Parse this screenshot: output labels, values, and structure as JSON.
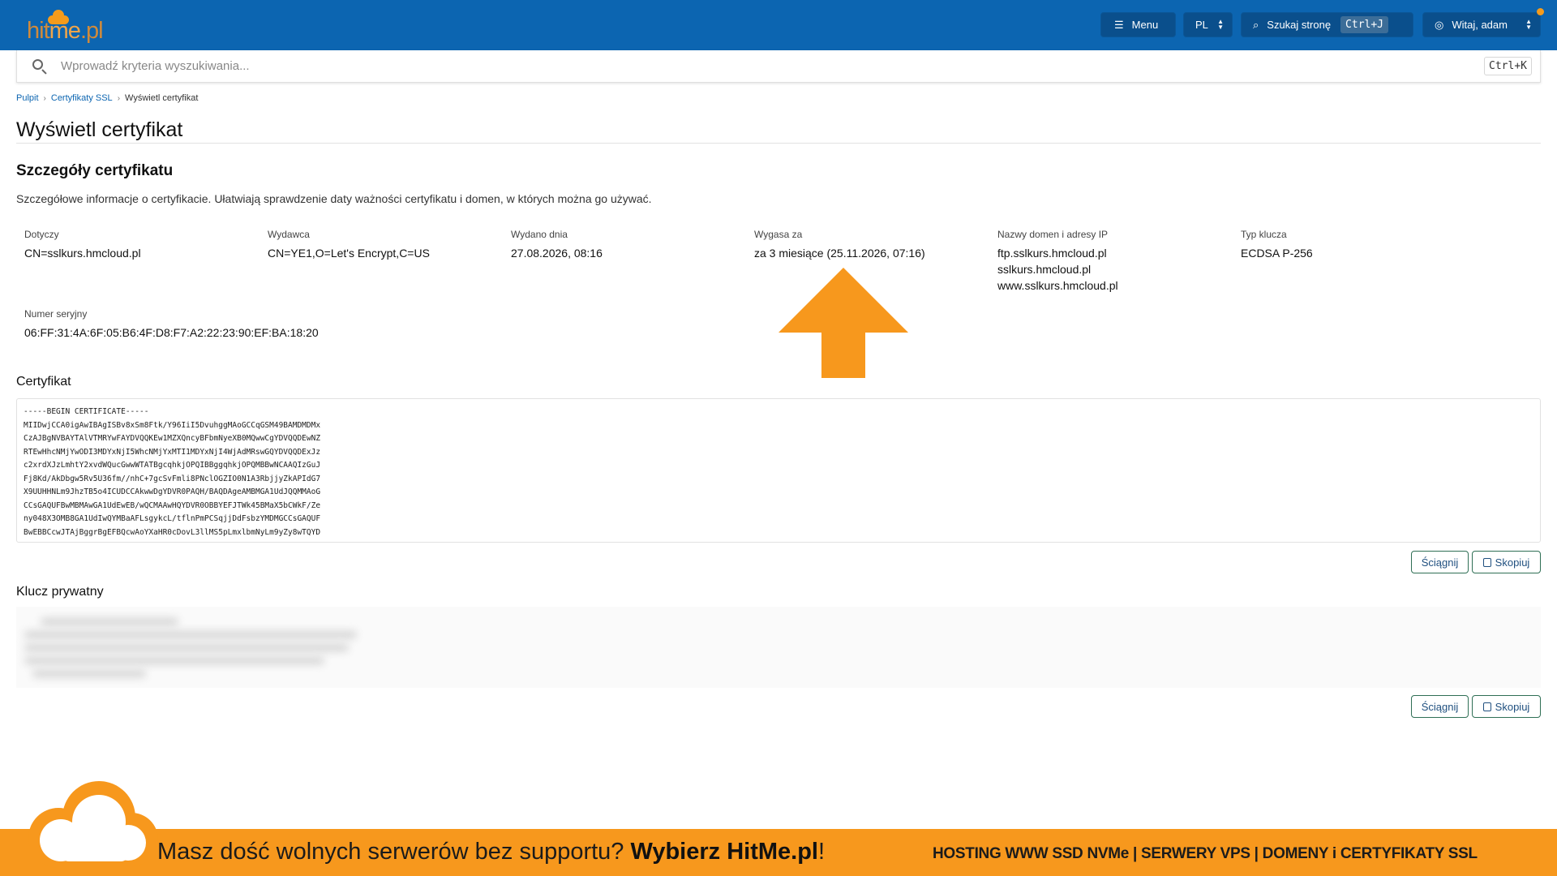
{
  "header": {
    "logo_text_a": "hit",
    "logo_text_b": "me",
    "logo_text_c": ".pl",
    "menu_label": "Menu",
    "lang_label": "PL",
    "search_label": "Szukaj stronę",
    "search_shortcut": "Ctrl+J",
    "user_label": "Witaj, adam"
  },
  "search": {
    "placeholder": "Wprowadź kryteria wyszukiwania...",
    "shortcut": "Ctrl+K"
  },
  "breadcrumb": {
    "items": [
      "Pulpit",
      "Certyfikaty SSL",
      "Wyświetl certyfikat"
    ]
  },
  "page": {
    "title": "Wyświetl certyfikat"
  },
  "details": {
    "title": "Szczegóły certyfikatu",
    "description": "Szczegółowe informacje o certyfikacie. Ułatwiają sprawdzenie daty ważności certyfikatu i domen, w których można go używać.",
    "fields": [
      {
        "label": "Dotyczy",
        "value": "CN=sslkurs.hmcloud.pl"
      },
      {
        "label": "Wydawca",
        "value": "CN=YE1,O=Let's Encrypt,C=US"
      },
      {
        "label": "Wydano dnia",
        "value": "27.08.2026, 08:16"
      },
      {
        "label": "Wygasa za",
        "value": "za 3 miesiące (25.11.2026, 07:16)"
      },
      {
        "label": "Nazwy domen i adresy IP",
        "values": [
          "ftp.sslkurs.hmcloud.pl",
          "sslkurs.hmcloud.pl",
          "www.sslkurs.hmcloud.pl"
        ]
      },
      {
        "label": "Typ klucza",
        "value": "ECDSA P-256"
      },
      {
        "label": "Numer seryjny",
        "value": "06:FF:31:4A:6F:05:B6:4F:D8:F7:A2:22:23:90:EF:BA:18:20"
      }
    ]
  },
  "certificate": {
    "title": "Certyfikat",
    "text": "-----BEGIN CERTIFICATE-----\nMIIDwjCCA0igAwIBAgISBv8xSm8Ftk/Y96IiI5DvuhggMAoGCCqGSM49BAMDMDMx\nCzAJBgNVBAYTAlVTMRYwFAYDVQQKEw1MZXQncyBFbmNyeXB0MQwwCgYDVQQDEwNZ\nRTEwHhcNMjYwODI3MDYxNjI5WhcNMjYxMTI1MDYxNjI4WjAdMRswGQYDVQQDExJz\nc2xrdXJzLmhtY2xvdWQucGwwWTATBgcqhkjOPQIBBggqhkjOPQMBBwNCAAQIzGuJ\nFj8Kd/AkDbgw5Rv5U36fm//nhC+7gcSvFmli8PNclOGZIO0N1A3RbjjyZkAPIdG7\nX9UUHHNLm9JhzTB5o4ICUDCCAkwwDgYDVR0PAQH/BAQDAgeAMBMGA1UdJQQMMAoG\nCCsGAQUFBwMBMAwGA1UdEwEB/wQCMAAwHQYDVR0OBBYEFJTWk45BMaX5bCWkF/Ze\nny048X3OMB8GA1UdIwQYMBaAFLsgykcL/tflnPmPCSqjjDdFsbzYMDMGCCsGAQUF\nBwEBBCcwJTAjBggrBgEFBQcwAoYXaHR0cDovL3llMS5pLmxlbmNyLm9yZy8wTQYD"
  },
  "private_key": {
    "title": "Klucz prywatny"
  },
  "actions": {
    "download_label": "Ściągnij",
    "copy_label": "Skopiuj"
  },
  "banner": {
    "left_regular": "Masz dość wolnych serwerów bez supportu? ",
    "left_bold": "Wybierz HitMe.pl",
    "left_end": "!",
    "right": "HOSTING WWW SSD NVMe | SERWERY VPS | DOMENY i CERTYFIKATY SSL"
  },
  "colors": {
    "header_bg": "#0c65b1",
    "accent_orange": "#f7981d",
    "link_blue": "#0c65b1"
  }
}
